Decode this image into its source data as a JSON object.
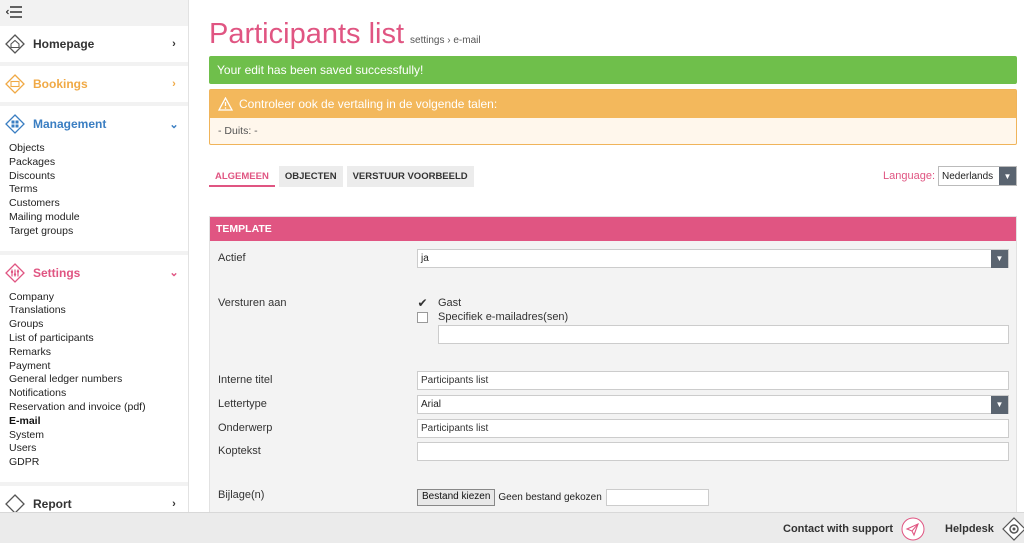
{
  "sidebar": {
    "sections": [
      {
        "label": "Homepage",
        "color": "#333333",
        "expanded": false,
        "items": []
      },
      {
        "label": "Bookings",
        "color": "#f0a945",
        "expanded": false,
        "items": []
      },
      {
        "label": "Management",
        "color": "#3a7ec2",
        "expanded": true,
        "items": [
          "Objects",
          "Packages",
          "Discounts",
          "Terms",
          "Customers",
          "Mailing module",
          "Target groups"
        ]
      },
      {
        "label": "Settings",
        "color": "#e05582",
        "expanded": true,
        "items": [
          "Company",
          "Translations",
          "Groups",
          "List of participants",
          "Remarks",
          "Payment",
          "General ledger numbers",
          "Notifications",
          "Reservation and invoice (pdf)",
          "E-mail",
          "System",
          "Users",
          "GDPR"
        ],
        "active_item": "E-mail"
      },
      {
        "label": "Report",
        "color": "#333333",
        "expanded": false,
        "items": []
      }
    ]
  },
  "header": {
    "title": "Participants list",
    "breadcrumb": "settings › e-mail"
  },
  "alerts": {
    "success": "Your edit has been saved successfully!",
    "warning_title": "Controleer ook de vertaling in de volgende talen:",
    "warning_body": "-  Duits: -"
  },
  "tabs": [
    {
      "label": "ALGEMEEN",
      "active": true
    },
    {
      "label": "OBJECTEN",
      "active": false
    },
    {
      "label": "VERSTUUR VOORBEELD",
      "active": false
    }
  ],
  "language": {
    "label": "Language:",
    "value": "Nederlands"
  },
  "template": {
    "heading": "TEMPLATE",
    "actief": {
      "label": "Actief",
      "value": "ja"
    },
    "versturen": {
      "label": "Versturen aan",
      "option_guest": "Gast",
      "option_guest_checked": true,
      "option_specific": "Specifiek e-mailadres(sen)",
      "option_specific_checked": false,
      "specific_value": ""
    },
    "interne_titel": {
      "label": "Interne titel",
      "value": "Participants list"
    },
    "lettertype": {
      "label": "Lettertype",
      "value": "Arial"
    },
    "onderwerp": {
      "label": "Onderwerp",
      "value": "Participants list"
    },
    "koptekst": {
      "label": "Koptekst",
      "value": ""
    },
    "bijlage": {
      "label": "Bijlage(n)",
      "button": "Bestand kiezen",
      "status": "Geen bestand gekozen"
    }
  },
  "footer": {
    "support": "Contact with support",
    "helpdesk": "Helpdesk"
  },
  "colors": {
    "accent": "#e05582",
    "success": "#6fbf4b",
    "warning": "#f3b85c",
    "management": "#3a7ec2",
    "bookings": "#f0a945"
  }
}
